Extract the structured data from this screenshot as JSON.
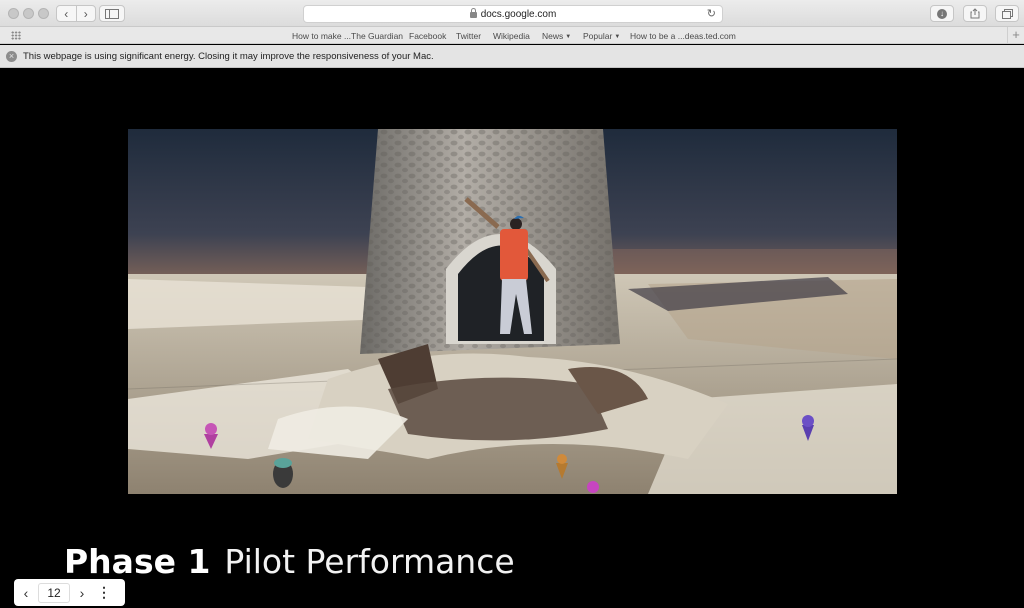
{
  "browser": {
    "url": "docs.google.com",
    "nav": {
      "back": "‹",
      "forward": "›"
    },
    "favorites": [
      {
        "label": "How to make ...The Guardian",
        "dropdown": false
      },
      {
        "label": "Facebook",
        "dropdown": false
      },
      {
        "label": "Twitter",
        "dropdown": false
      },
      {
        "label": "Wikipedia",
        "dropdown": false
      },
      {
        "label": "News",
        "dropdown": true
      },
      {
        "label": "Popular",
        "dropdown": true
      },
      {
        "label": "How to be a ...deas.ted.com",
        "dropdown": false
      }
    ],
    "notice": "This webpage is using significant energy. Closing it may improve the responsiveness of your Mac."
  },
  "slide": {
    "title_bold": "Phase 1",
    "title_light": "Pilot Performance",
    "image_description_icon": "photogrammetry-scene-icon"
  },
  "slide_nav": {
    "prev": "‹",
    "page": "12",
    "next": "›",
    "more": "⋮"
  },
  "colors": {
    "background": "#000000",
    "chrome": "#e6e6e6",
    "title_text": "#ffffff"
  }
}
